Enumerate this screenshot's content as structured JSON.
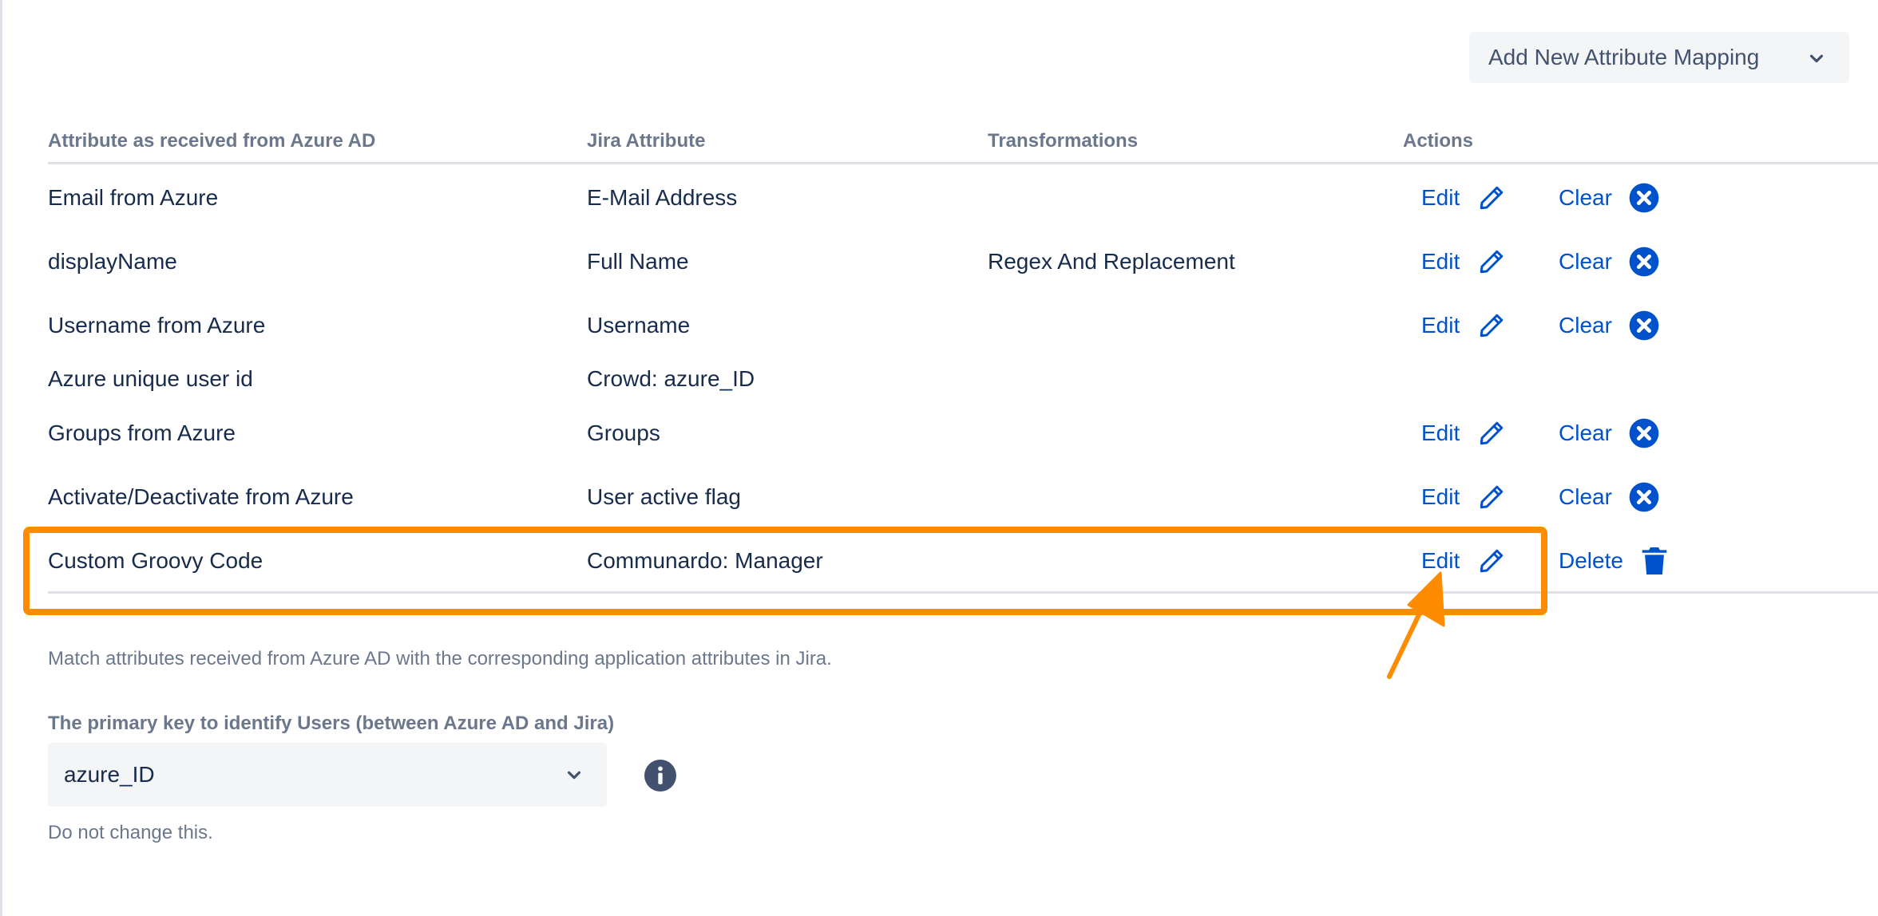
{
  "toolbar": {
    "add_mapping_label": "Add New Attribute Mapping"
  },
  "table": {
    "headers": {
      "source": "Attribute as received from Azure AD",
      "jira": "Jira Attribute",
      "transform": "Transformations",
      "actions": "Actions"
    },
    "action_labels": {
      "edit": "Edit",
      "clear": "Clear",
      "delete": "Delete"
    },
    "rows": [
      {
        "source": "Email from Azure",
        "jira": "E-Mail Address",
        "transform": ""
      },
      {
        "source": "displayName",
        "jira": "Full Name",
        "transform": "Regex And Replacement"
      },
      {
        "source": "Username from Azure",
        "jira": "Username",
        "transform": ""
      },
      {
        "source": "Azure unique user id",
        "jira": "Crowd: azure_ID",
        "transform": ""
      },
      {
        "source": "Groups from Azure",
        "jira": "Groups",
        "transform": ""
      },
      {
        "source": "Activate/Deactivate from Azure",
        "jira": "User active flag",
        "transform": ""
      },
      {
        "source": "Custom Groovy Code",
        "jira": "Communardo: Manager",
        "transform": ""
      }
    ]
  },
  "help_text": "Match attributes received from Azure AD with the corresponding application attributes in Jira.",
  "primary_key": {
    "label": "The primary key to identify Users (between Azure AD and Jira)",
    "value": "azure_ID",
    "hint": "Do not change this."
  },
  "colors": {
    "link": "#0052cc",
    "highlight": "#ff8b00",
    "muted": "#6b778c"
  },
  "icons": {
    "edit": "pencil-icon",
    "clear": "x-circle-icon",
    "delete": "trash-icon",
    "dropdown": "chevron-down-icon",
    "info": "info-icon"
  }
}
